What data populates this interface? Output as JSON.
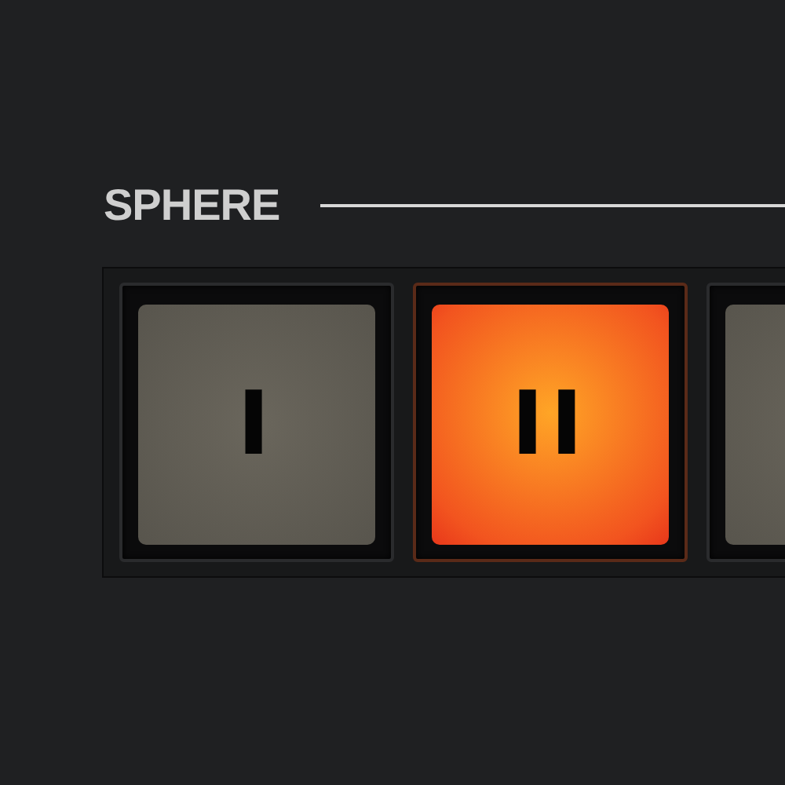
{
  "section": {
    "title": "SPHERE"
  },
  "pads": [
    {
      "label": "I",
      "selected": false
    },
    {
      "label": "II",
      "selected": true
    },
    {
      "selected": false
    }
  ]
}
